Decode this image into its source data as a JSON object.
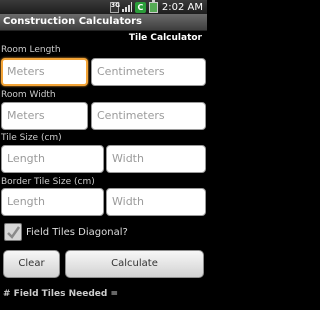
{
  "status": {
    "network": "3G",
    "time": "2:02 AM"
  },
  "app": {
    "title": "Construction Calculators",
    "screen_title": "Tile Calculator"
  },
  "room_length": {
    "label": "Room Length",
    "meters_placeholder": "Meters",
    "centimeters_placeholder": "Centimeters"
  },
  "room_width": {
    "label": "Room Width",
    "meters_placeholder": "Meters",
    "centimeters_placeholder": "Centimeters"
  },
  "tile_size": {
    "label": "Tile Size (cm)",
    "length_placeholder": "Length",
    "width_placeholder": "Width"
  },
  "border_tile_size": {
    "label": "Border Tile Size (cm)",
    "length_placeholder": "Length",
    "width_placeholder": "Width"
  },
  "diagonal": {
    "label": "Field Tiles Diagonal?",
    "checked": true
  },
  "buttons": {
    "clear": "Clear",
    "calculate": "Calculate"
  },
  "result": {
    "label": "# Field Tiles Needed ="
  },
  "colors": {
    "focus": "#f3a437",
    "background": "#000000"
  }
}
